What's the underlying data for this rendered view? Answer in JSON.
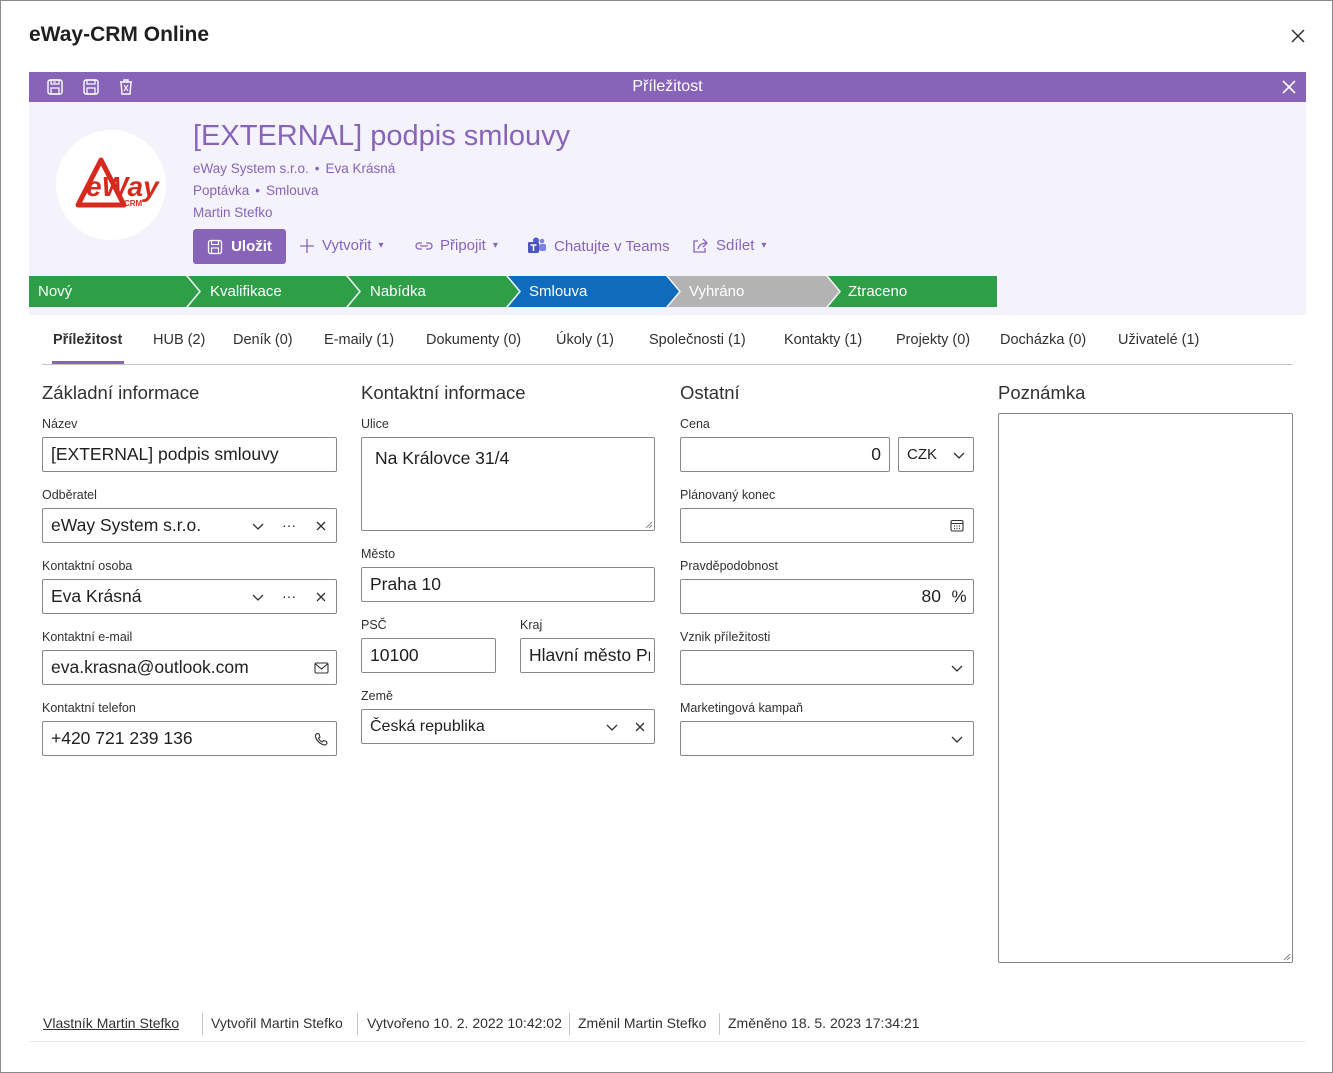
{
  "app": {
    "title": "eWay-CRM Online"
  },
  "titlebar": {
    "title": "Příležitost"
  },
  "header": {
    "title": "[EXTERNAL] podpis smlouvy",
    "company": "eWay System s.r.o.",
    "contact": "Eva Krásná",
    "type": "Poptávka",
    "stage": "Smlouva",
    "owner": "Martin Stefko",
    "logo_text": "eWay",
    "logo_sub": "CRM"
  },
  "commands": {
    "save": "Uložit",
    "create": "Vytvořit",
    "connect": "Připojit",
    "teams": "Chatujte v Teams",
    "share": "Sdílet"
  },
  "stages": [
    {
      "label": "Nový",
      "color": "#2e9e47"
    },
    {
      "label": "Kvalifikace",
      "color": "#2e9e47"
    },
    {
      "label": "Nabídka",
      "color": "#2e9e47"
    },
    {
      "label": "Smlouva",
      "color": "#0f6cbd"
    },
    {
      "label": "Vyhráno",
      "color": "#b3b3b3"
    },
    {
      "label": "Ztraceno",
      "color": "#2e9e47"
    }
  ],
  "tabs": [
    {
      "label": "Příležitost"
    },
    {
      "label": "HUB (2)"
    },
    {
      "label": "Deník (0)"
    },
    {
      "label": "E-maily (1)"
    },
    {
      "label": "Dokumenty (0)"
    },
    {
      "label": "Úkoly (1)"
    },
    {
      "label": "Společnosti (1)"
    },
    {
      "label": "Kontakty (1)"
    },
    {
      "label": "Projekty (0)"
    },
    {
      "label": "Docházka (0)"
    },
    {
      "label": "Uživatelé (1)"
    }
  ],
  "basic": {
    "section": "Základní informace",
    "name_label": "Název",
    "name_value": "[EXTERNAL] podpis smlouvy",
    "customer_label": "Odběratel",
    "customer_value": "eWay System s.r.o.",
    "contact_label": "Kontaktní osoba",
    "contact_value": "Eva Krásná",
    "email_label": "Kontaktní e-mail",
    "email_value": "eva.krasna@outlook.com",
    "phone_label": "Kontaktní telefon",
    "phone_value": "+420 721 239 136"
  },
  "contact_info": {
    "section": "Kontaktní informace",
    "street_label": "Ulice",
    "street_value": "Na Královce 31/4",
    "city_label": "Město",
    "city_value": "Praha 10",
    "zip_label": "PSČ",
    "zip_value": "10100",
    "region_label": "Kraj",
    "region_value": "Hlavní město Praha",
    "country_label": "Země",
    "country_value": "Česká republika"
  },
  "other": {
    "section": "Ostatní",
    "price_label": "Cena",
    "price_value": "0",
    "currency": "CZK",
    "end_label": "Plánovaný konec",
    "end_value": "",
    "prob_label": "Pravděpodobnost",
    "prob_value": "80",
    "prob_unit": "%",
    "origin_label": "Vznik příležitosti",
    "origin_value": "",
    "campaign_label": "Marketingová kampaň",
    "campaign_value": ""
  },
  "note": {
    "section": "Poznámka",
    "value": ""
  },
  "footer": {
    "owner": "Vlastník Martin Stefko",
    "created_by": "Vytvořil Martin Stefko",
    "created_at": "Vytvořeno 10. 2. 2022 10:42:02",
    "modified_by": "Změnil Martin Stefko",
    "modified_at": "Změněno 18. 5. 2023 17:34:21"
  }
}
